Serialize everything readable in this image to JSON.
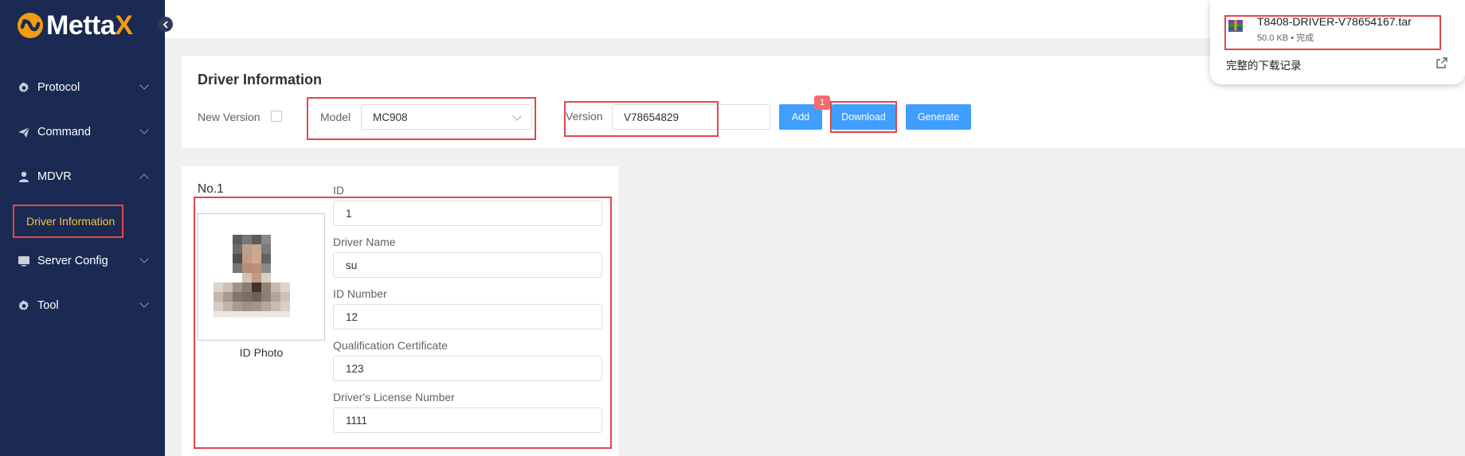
{
  "app": {
    "logo_text": "MettaX",
    "accent_color": "#f39c12",
    "sidebar_color": "#1b2a52"
  },
  "sidebar": {
    "collapse_icon": "chevron-left-icon",
    "items": [
      {
        "label": "Protocol",
        "icon": "gear-icon",
        "expanded": false
      },
      {
        "label": "Command",
        "icon": "send-icon",
        "expanded": false
      },
      {
        "label": "MDVR",
        "icon": "user-icon",
        "expanded": true
      },
      {
        "label": "Server Config",
        "icon": "monitor-icon",
        "expanded": false
      },
      {
        "label": "Tool",
        "icon": "gear-icon",
        "expanded": false
      }
    ],
    "sub_items": [
      {
        "label": "Driver Information",
        "active": true
      }
    ]
  },
  "driver_panel": {
    "title": "Driver Information",
    "new_version_label": "New Version",
    "new_version_checked": false,
    "model_label": "Model",
    "model_value": "MC908",
    "version_label": "Version",
    "version_value": "V78654829",
    "add_label": "Add",
    "download_label": "Download",
    "download_badge": "1",
    "generate_label": "Generate"
  },
  "record": {
    "number_label": "No.1",
    "photo_label": "ID Photo",
    "fields": [
      {
        "label": "ID",
        "value": "1"
      },
      {
        "label": "Driver Name",
        "value": "su"
      },
      {
        "label": "ID Number",
        "value": "12"
      },
      {
        "label": "Qualification Certificate",
        "value": "123"
      },
      {
        "label": "Driver's License Number",
        "value": "1111"
      }
    ]
  },
  "download_popup": {
    "file_name": "T8408-DRIVER-V78654167.tar",
    "file_meta": "50.0 KB • 完成",
    "history_label": "完整的下载记录",
    "open_icon": "external-link-icon"
  }
}
